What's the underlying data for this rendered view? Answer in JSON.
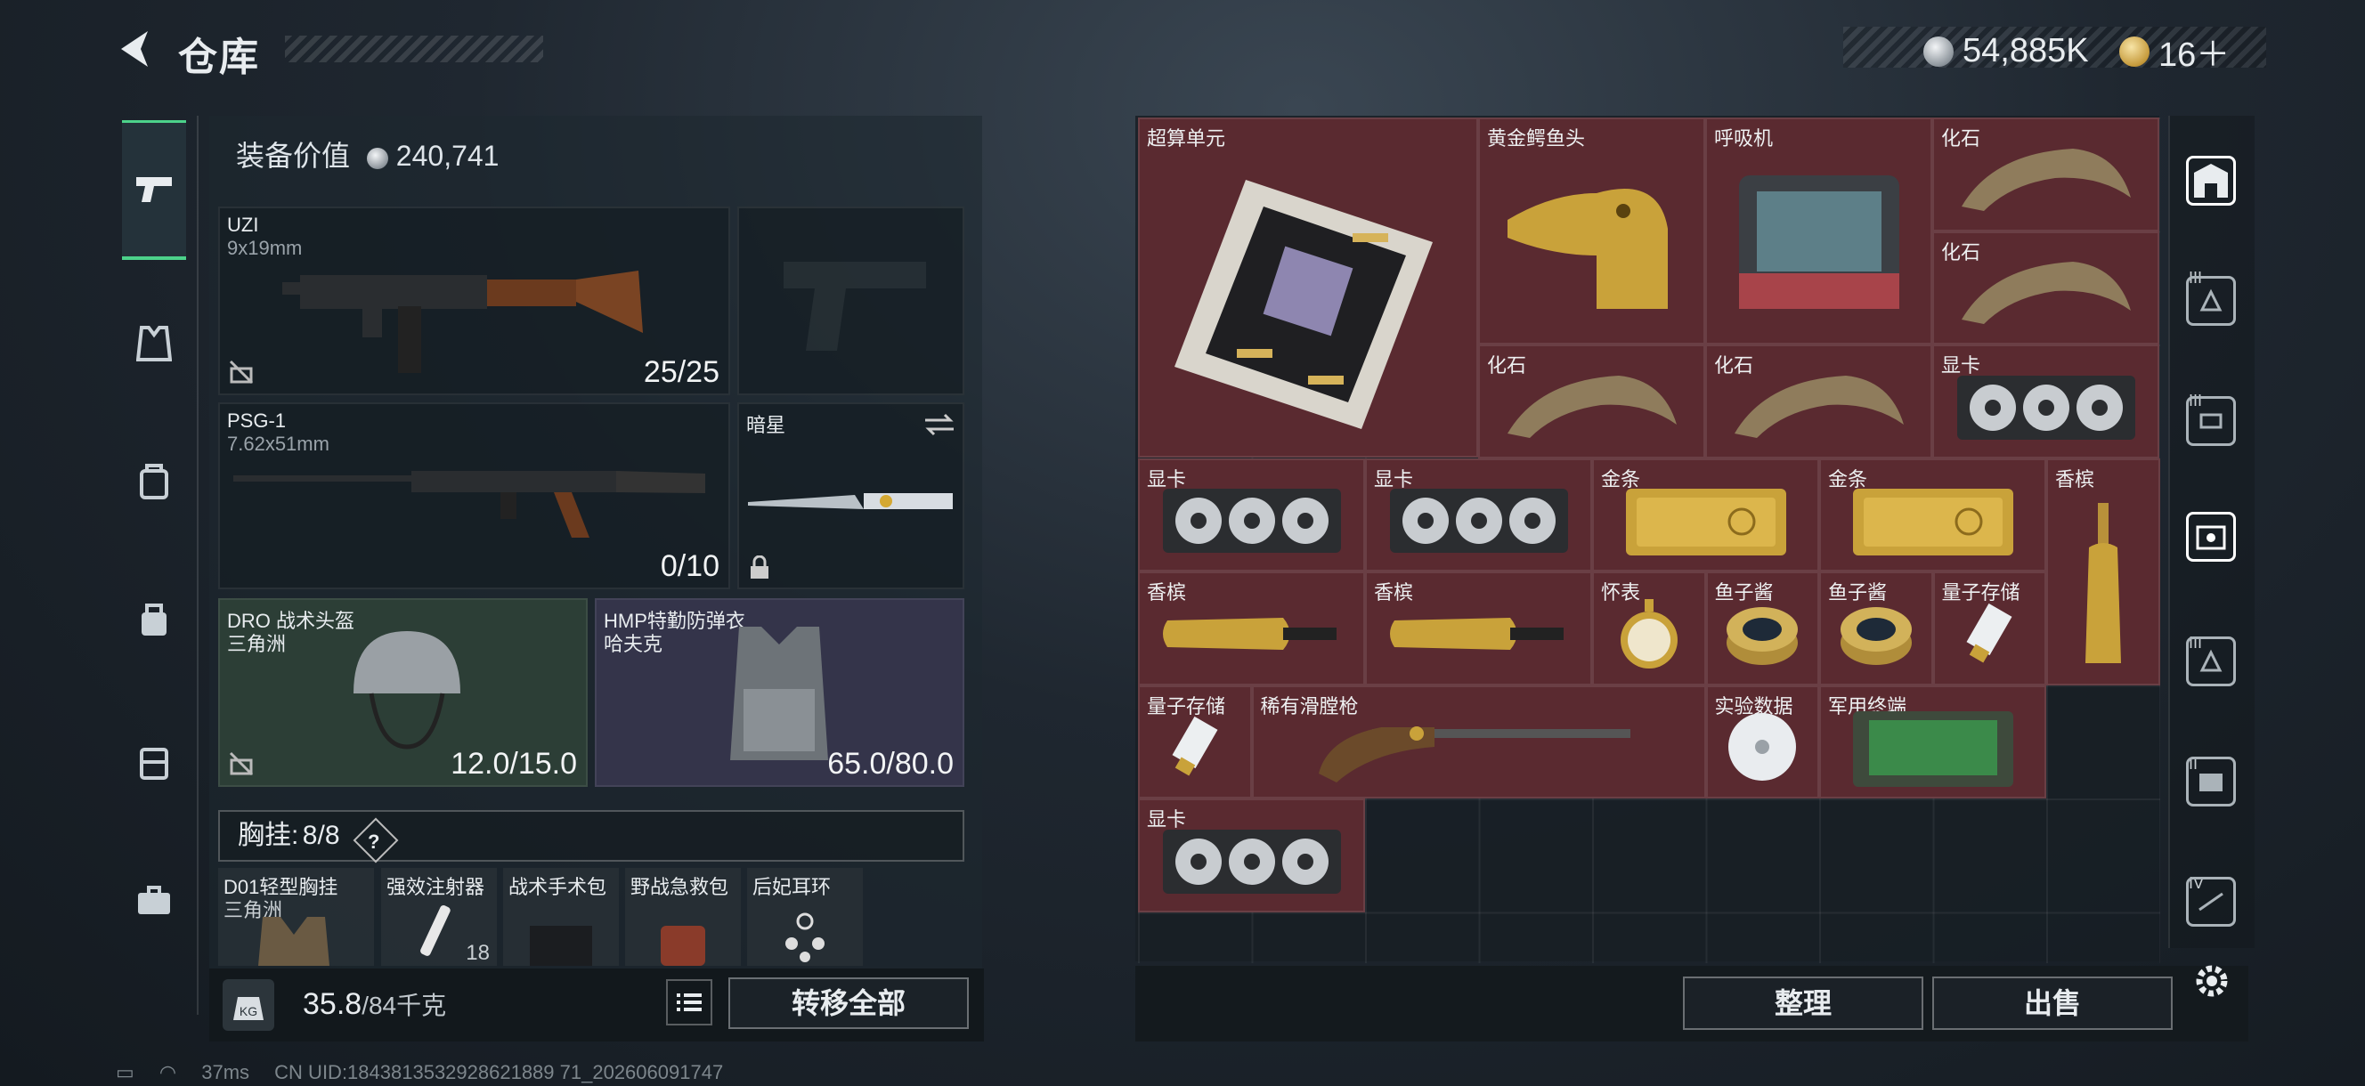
{
  "header": {
    "title": "仓库",
    "silver_amount": "54,885K",
    "gold_amount": "16＋",
    "silver_icon": "silver-coin-icon",
    "gold_icon": "gold-coin-icon"
  },
  "leftnav": {
    "items": [
      "pistol-icon",
      "vest-icon",
      "backpack-icon",
      "bag-icon",
      "case-icon",
      "toolbox-icon"
    ]
  },
  "equipment": {
    "value_label": "装备价值",
    "value": "240,741",
    "slots": [
      {
        "name": "UZI",
        "sub": "9x19mm",
        "value": "25/25"
      },
      {
        "name": "PSG-1",
        "sub": "7.62x51mm",
        "value": "0/10"
      },
      {
        "name": "暗星",
        "sub": "",
        "value": ""
      },
      {
        "name": "DRO 战术头盔",
        "sub": "三角洲",
        "value": "12.0/15.0"
      },
      {
        "name": "HMP特勤防弹衣",
        "sub": "哈夫克",
        "value": "65.0/80.0"
      }
    ],
    "chest": {
      "label": "胸挂:",
      "count": "8/8",
      "help": "?"
    },
    "chest_items": [
      {
        "name": "D01轻型胸挂",
        "sub": "三角洲"
      },
      {
        "name": "强效注射器",
        "sub": "18"
      },
      {
        "name": "战术手术包",
        "sub": ""
      },
      {
        "name": "野战急救包",
        "sub": ""
      },
      {
        "name": "后妃耳环",
        "sub": ""
      }
    ],
    "weight": "35.8",
    "weight_max": "/84千克",
    "transfer_all": "转移全部"
  },
  "warehouse": {
    "items": [
      {
        "name": "超算单元"
      },
      {
        "name": "黄金鳄鱼头"
      },
      {
        "name": "呼吸机"
      },
      {
        "name": "化石"
      },
      {
        "name": "化石"
      },
      {
        "name": "化石"
      },
      {
        "name": "化石"
      },
      {
        "name": "显卡"
      },
      {
        "name": "显卡"
      },
      {
        "name": "显卡"
      },
      {
        "name": "金条"
      },
      {
        "name": "金条"
      },
      {
        "name": "香槟"
      },
      {
        "name": "香槟"
      },
      {
        "name": "香槟"
      },
      {
        "name": "怀表"
      },
      {
        "name": "鱼子酱"
      },
      {
        "name": "鱼子酱"
      },
      {
        "name": "量子存储"
      },
      {
        "name": "量子存储"
      },
      {
        "name": "稀有滑膛枪"
      },
      {
        "name": "实验数据"
      },
      {
        "name": "军用终端"
      },
      {
        "name": "显卡"
      }
    ],
    "sort_label": "整理",
    "sell_label": "出售"
  },
  "right_rail": {
    "tiers": [
      "III",
      "III",
      "III",
      "II",
      "IV"
    ]
  },
  "status": {
    "ping": "37ms",
    "uid": "CN UID:1843813532928621889 71_202606091747"
  },
  "colors": {
    "item_bg": "#5a2a30",
    "accent_green": "#4cd28a"
  }
}
